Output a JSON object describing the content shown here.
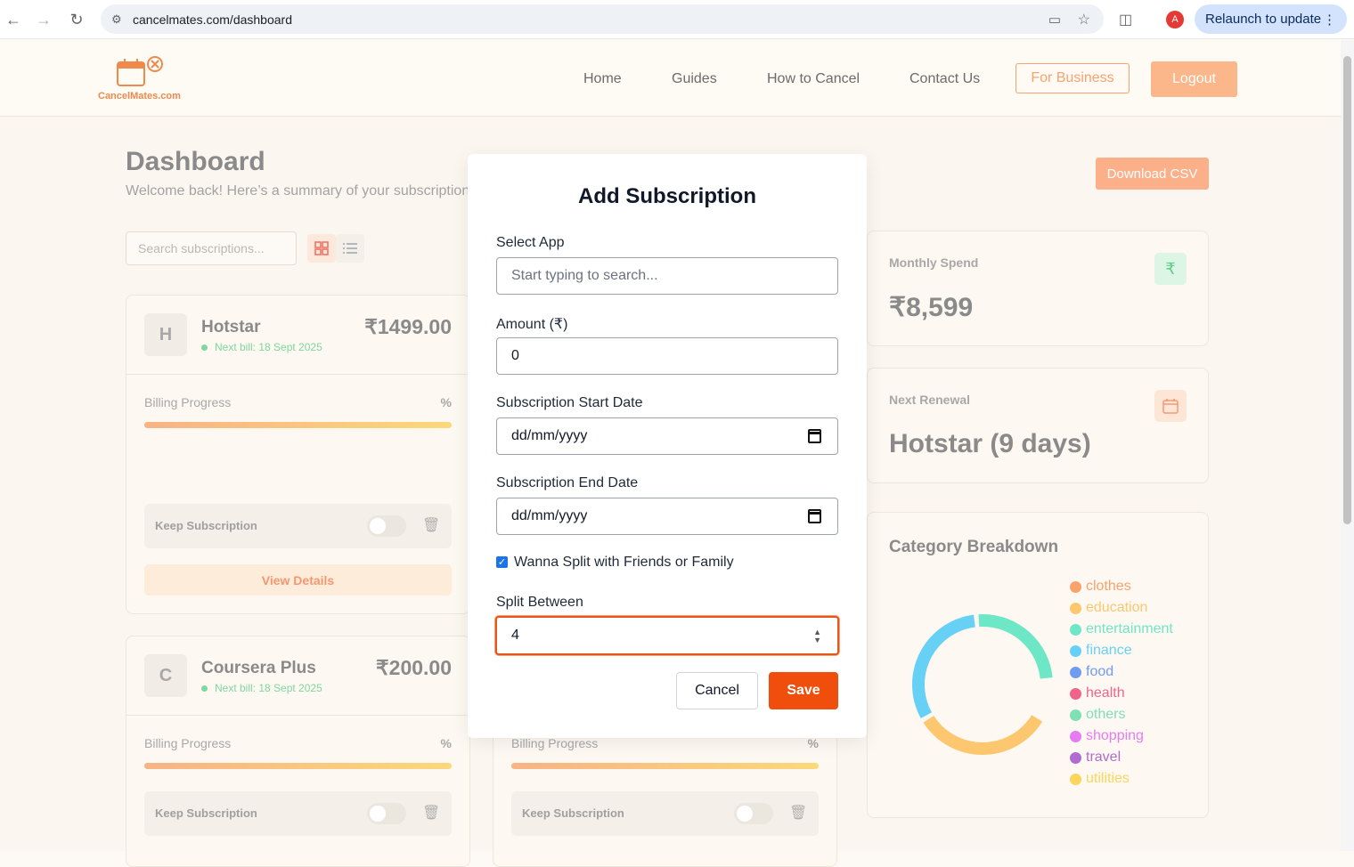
{
  "browser": {
    "url": "cancelmates.com/dashboard",
    "relaunch_label": "Relaunch to update",
    "profile_initial": "A"
  },
  "header": {
    "logo_text": "CancelMates.com",
    "nav": [
      "Home",
      "Guides",
      "How to Cancel",
      "Contact Us"
    ],
    "business_label": "For Business",
    "logout_label": "Logout"
  },
  "dashboard": {
    "title": "Dashboard",
    "subtitle": "Welcome back! Here’s a summary of your subscriptions",
    "csv_label": "Download CSV",
    "search_placeholder": "Search subscriptions..."
  },
  "cards": [
    {
      "letter": "H",
      "name": "Hotstar",
      "price": "₹1499.00",
      "next_bill": "Next bill: 18 Sept 2025",
      "billing_label": "Billing Progress",
      "billing_pct": "%",
      "keep_label": "Keep Subscription",
      "details_label": "View Details"
    },
    {
      "letter": "C",
      "name": "Coursera Plus",
      "price": "₹200.00",
      "next_bill": "Next bill: 18 Sept 2025",
      "billing_label": "Billing Progress",
      "billing_pct": "%",
      "keep_label": "Keep Subscription"
    },
    {
      "billing_label": "Billing Progress",
      "billing_pct": "%",
      "keep_label": "Keep Subscription"
    }
  ],
  "stats": {
    "monthly_label": "Monthly Spend",
    "monthly_value": "₹8,599",
    "renewal_label": "Next Renewal",
    "renewal_value": "Hotstar (9 days)",
    "category_title": "Category Breakdown",
    "categories": [
      {
        "name": "clothes",
        "color": "#f9a26c"
      },
      {
        "name": "education",
        "color": "#fcc76f"
      },
      {
        "name": "entertainment",
        "color": "#6ee7c7"
      },
      {
        "name": "finance",
        "color": "#67d1f5"
      },
      {
        "name": "food",
        "color": "#6f9cf1"
      },
      {
        "name": "health",
        "color": "#f0648a"
      },
      {
        "name": "others",
        "color": "#7ee0b5"
      },
      {
        "name": "shopping",
        "color": "#e57cf2"
      },
      {
        "name": "travel",
        "color": "#b06cd1"
      },
      {
        "name": "utilities",
        "color": "#fcd55c"
      }
    ]
  },
  "modal": {
    "title": "Add Subscription",
    "app_label": "Select App",
    "app_placeholder": "Start typing to search...",
    "amount_label": "Amount (₹)",
    "amount_value": "0",
    "start_label": "Subscription Start Date",
    "start_value": "dd/mm/yyyy",
    "end_label": "Subscription End Date",
    "end_value": "dd/mm/yyyy",
    "split_check_label": "Wanna Split with Friends or Family",
    "split_label": "Split Between",
    "split_value": "4",
    "cancel_label": "Cancel",
    "save_label": "Save"
  }
}
